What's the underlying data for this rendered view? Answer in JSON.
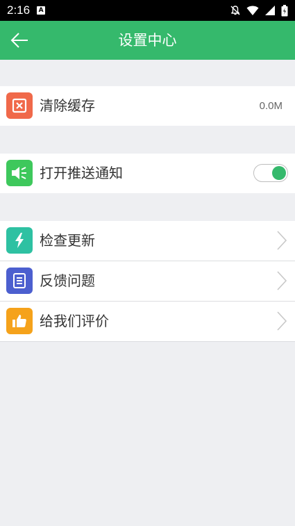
{
  "status_bar": {
    "time": "2:16",
    "notif_letter": "A"
  },
  "app_bar": {
    "title": "设置中心"
  },
  "settings": {
    "clear_cache": {
      "label": "清除缓存",
      "value": "0.0M"
    },
    "push": {
      "label": "打开推送通知",
      "enabled": true
    },
    "check_update": {
      "label": "检查更新"
    },
    "feedback": {
      "label": "反馈问题"
    },
    "rate": {
      "label": "给我们评价"
    }
  },
  "colors": {
    "header": "#35b96c",
    "clear_cache_icon": "#f0694a",
    "push_icon": "#3ec85c",
    "update_icon": "#2ec1a2",
    "feedback_icon": "#4c5fcf",
    "rate_icon": "#f5a21b"
  },
  "icons": {
    "back": "arrow-left-icon",
    "clear_cache": "close-box-icon",
    "push": "speaker-icon",
    "update": "lightning-icon",
    "feedback": "document-icon",
    "rate": "thumbs-up-icon"
  }
}
